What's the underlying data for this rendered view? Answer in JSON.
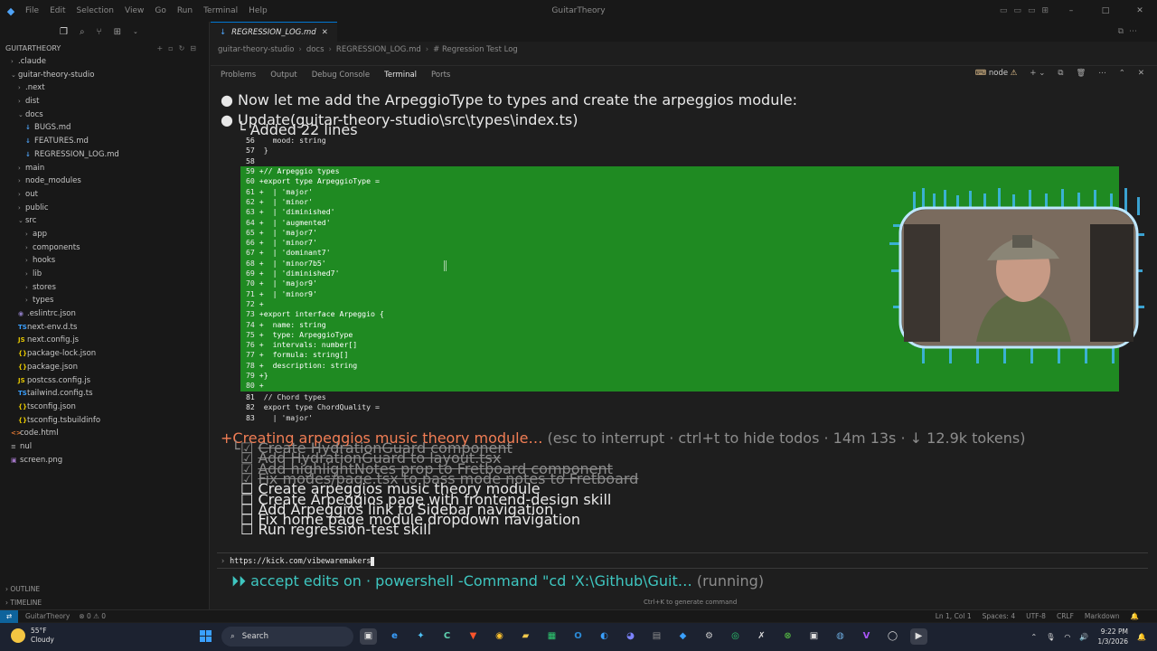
{
  "titlebar": {
    "menu": [
      "File",
      "Edit",
      "Selection",
      "View",
      "Go",
      "Run",
      "Terminal",
      "Help"
    ],
    "title": "GuitarTheory"
  },
  "sidebar": {
    "section_title": "GUITARTHEORY",
    "items": [
      {
        "label": ".claude",
        "kind": "folder",
        "indent": 1,
        "open": false
      },
      {
        "label": "guitar-theory-studio",
        "kind": "folder",
        "indent": 1,
        "open": true
      },
      {
        "label": ".next",
        "kind": "folder",
        "indent": 2,
        "open": false
      },
      {
        "label": "dist",
        "kind": "folder",
        "indent": 2,
        "open": false
      },
      {
        "label": "docs",
        "kind": "folder",
        "indent": 2,
        "open": true
      },
      {
        "label": "BUGS.md",
        "kind": "md",
        "indent": 3
      },
      {
        "label": "FEATURES.md",
        "kind": "md",
        "indent": 3
      },
      {
        "label": "REGRESSION_LOG.md",
        "kind": "md",
        "indent": 3
      },
      {
        "label": "main",
        "kind": "folder",
        "indent": 2,
        "open": false
      },
      {
        "label": "node_modules",
        "kind": "folder",
        "indent": 2,
        "open": false
      },
      {
        "label": "out",
        "kind": "folder",
        "indent": 2,
        "open": false
      },
      {
        "label": "public",
        "kind": "folder",
        "indent": 2,
        "open": false
      },
      {
        "label": "src",
        "kind": "folder",
        "indent": 2,
        "open": true
      },
      {
        "label": "app",
        "kind": "folder",
        "indent": 3,
        "open": false
      },
      {
        "label": "components",
        "kind": "folder",
        "indent": 3,
        "open": false
      },
      {
        "label": "hooks",
        "kind": "folder",
        "indent": 3,
        "open": false
      },
      {
        "label": "lib",
        "kind": "folder",
        "indent": 3,
        "open": false
      },
      {
        "label": "stores",
        "kind": "folder",
        "indent": 3,
        "open": false
      },
      {
        "label": "types",
        "kind": "folder",
        "indent": 3,
        "open": false
      },
      {
        "label": ".eslintrc.json",
        "kind": "eslint",
        "indent": 2
      },
      {
        "label": "next-env.d.ts",
        "kind": "ts",
        "indent": 2
      },
      {
        "label": "next.config.js",
        "kind": "js",
        "indent": 2
      },
      {
        "label": "package-lock.json",
        "kind": "json",
        "indent": 2
      },
      {
        "label": "package.json",
        "kind": "json",
        "indent": 2
      },
      {
        "label": "postcss.config.js",
        "kind": "js",
        "indent": 2
      },
      {
        "label": "tailwind.config.ts",
        "kind": "ts",
        "indent": 2
      },
      {
        "label": "tsconfig.json",
        "kind": "json",
        "indent": 2
      },
      {
        "label": "tsconfig.tsbuildinfo",
        "kind": "json",
        "indent": 2
      },
      {
        "label": "code.html",
        "kind": "html",
        "indent": 1
      },
      {
        "label": "nul",
        "kind": "txt",
        "indent": 1
      },
      {
        "label": "screen.png",
        "kind": "png",
        "indent": 1
      }
    ],
    "outline_label": "OUTLINE",
    "timeline_label": "TIMELINE"
  },
  "editor": {
    "tab_label": "REGRESSION_LOG.md",
    "breadcrumb": [
      "guitar-theory-studio",
      "docs",
      "REGRESSION_LOG.md",
      "# Regression Test Log"
    ]
  },
  "panel": {
    "tabs": [
      "Problems",
      "Output",
      "Debug Console",
      "Terminal",
      "Ports"
    ],
    "active_tab": "Terminal",
    "shell_label": "node"
  },
  "terminal": {
    "intro": "● Now let me add the ArpeggioType to types and create the arpeggios module:",
    "update": "● Update(guitar-theory-studio\\src\\types\\index.ts)",
    "added": "  └ Added 22 lines",
    "context_before": [
      {
        "n": "56",
        "text": "   mood: string"
      },
      {
        "n": "57",
        "text": " }"
      },
      {
        "n": "58",
        "text": ""
      }
    ],
    "added_lines": [
      {
        "n": "59",
        "text": "+// Arpeggio types"
      },
      {
        "n": "60",
        "text": "+export type ArpeggioType ="
      },
      {
        "n": "61",
        "text": "+  | 'major'"
      },
      {
        "n": "62",
        "text": "+  | 'minor'"
      },
      {
        "n": "63",
        "text": "+  | 'diminished'"
      },
      {
        "n": "64",
        "text": "+  | 'augmented'"
      },
      {
        "n": "65",
        "text": "+  | 'major7'"
      },
      {
        "n": "66",
        "text": "+  | 'minor7'"
      },
      {
        "n": "67",
        "text": "+  | 'dominant7'"
      },
      {
        "n": "68",
        "text": "+  | 'minor7b5'"
      },
      {
        "n": "69",
        "text": "+  | 'diminished7'"
      },
      {
        "n": "70",
        "text": "+  | 'major9'"
      },
      {
        "n": "71",
        "text": "+  | 'minor9'"
      },
      {
        "n": "72",
        "text": "+"
      },
      {
        "n": "73",
        "text": "+export interface Arpeggio {"
      },
      {
        "n": "74",
        "text": "+  name: string"
      },
      {
        "n": "75",
        "text": "+  type: ArpeggioType"
      },
      {
        "n": "76",
        "text": "+  intervals: number[]"
      },
      {
        "n": "77",
        "text": "+  formula: string[]"
      },
      {
        "n": "78",
        "text": "+  description: string"
      },
      {
        "n": "79",
        "text": "+}"
      },
      {
        "n": "80",
        "text": "+"
      }
    ],
    "context_after": [
      {
        "n": "81",
        "text": " // Chord types"
      },
      {
        "n": "82",
        "text": " export type ChordQuality ="
      },
      {
        "n": "83",
        "text": "   | 'major'"
      }
    ],
    "status_prefix": "+Creating arpeggios music theory module…",
    "status_suffix": " (esc to interrupt · ctrl+t to hide todos · 14m 13s · ↓ 12.9k tokens)",
    "todos": [
      {
        "text": "Create HydrationGuard component",
        "done": true
      },
      {
        "text": "Add HydrationGuard to layout.tsx",
        "done": true
      },
      {
        "text": "Add highlightNotes prop to Fretboard component",
        "done": true
      },
      {
        "text": "Fix modes/page.tsx to pass mode notes to Fretboard",
        "done": true
      },
      {
        "text": "Create arpeggios music theory module",
        "done": false
      },
      {
        "text": "Create Arpeggios page with frontend-design skill",
        "done": false
      },
      {
        "text": "Add Arpeggios link to Sidebar navigation",
        "done": false
      },
      {
        "text": "Fix home page module dropdown navigation",
        "done": false
      },
      {
        "text": "Run regression-test skill",
        "done": false
      }
    ],
    "input_value": "https://kick.com/vibewaremakers",
    "accept_label": "⏵⏵ accept edits on",
    "accept_cmd": " · powershell -Command \"cd 'X:\\Github\\Guit…",
    "accept_state": " (running)",
    "ctrl_k_hint": "Ctrl+K to generate command"
  },
  "statusbar": {
    "branch": "GuitarTheory",
    "problems": "⊗ 0 ⚠ 0",
    "position": "Ln 1, Col 1",
    "spaces": "Spaces: 4",
    "encoding": "UTF-8",
    "eol": "CRLF",
    "language": "Markdown"
  },
  "taskbar": {
    "temp": "55°F",
    "condition": "Cloudy",
    "search_label": "Search",
    "time": "9:22 PM",
    "date": "1/3/2026"
  },
  "colors": {
    "diff_added_bg": "#1f8a22",
    "accent": "#0078d4",
    "status_orange": "#f27e55"
  }
}
